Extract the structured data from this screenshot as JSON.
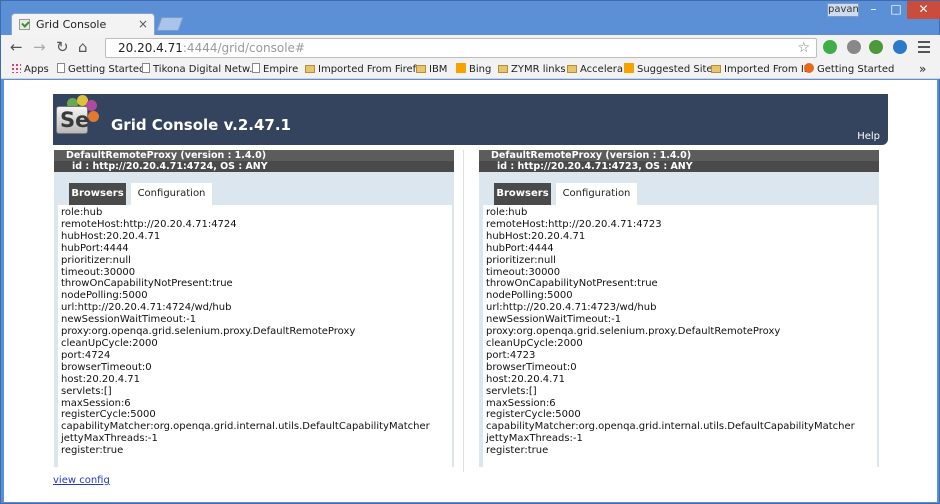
{
  "browser": {
    "tab_title": "Grid Console",
    "tab_close": "×",
    "user": "pavan",
    "min": "–",
    "max": "□",
    "close": "✕",
    "back": "←",
    "forward": "→",
    "reload": "↻",
    "home": "⌂",
    "url_host": "20.20.4.71",
    "url_path": ":4444/grid/console#",
    "star": "☆",
    "more": "»",
    "bookmarks": [
      {
        "label": "Apps",
        "icon": "apps-icon"
      },
      {
        "label": "Getting Started",
        "icon": "page-icon"
      },
      {
        "label": "Tikona Digital Netw...",
        "icon": "page-icon"
      },
      {
        "label": "Empire",
        "icon": "page-icon"
      },
      {
        "label": "Imported From Firef...",
        "icon": "folder-icon"
      },
      {
        "label": "IBM",
        "icon": "folder-icon"
      },
      {
        "label": "Bing",
        "icon": "bing-icon"
      },
      {
        "label": "ZYMR links",
        "icon": "folder-icon"
      },
      {
        "label": "Accelera",
        "icon": "folder-icon"
      },
      {
        "label": "Suggested Sites",
        "icon": "bing-icon"
      },
      {
        "label": "Imported From IE",
        "icon": "folder-icon"
      },
      {
        "label": "Getting Started",
        "icon": "firefox-icon"
      }
    ]
  },
  "page": {
    "logo_text": "Se",
    "title": "Grid Console v.2.47.1",
    "help": "Help",
    "view_config": "view config",
    "proxies": [
      {
        "title": "DefaultRemoteProxy (version : 1.4.0)",
        "id": "id : http://20.20.4.71:4724, OS : ANY",
        "tab_browsers": "Browsers",
        "tab_configuration": "Configuration",
        "config": [
          "role:hub",
          "remoteHost:http://20.20.4.71:4724",
          "hubHost:20.20.4.71",
          "hubPort:4444",
          "prioritizer:null",
          "timeout:30000",
          "throwOnCapabilityNotPresent:true",
          "nodePolling:5000",
          "url:http://20.20.4.71:4724/wd/hub",
          "newSessionWaitTimeout:-1",
          "proxy:org.openqa.grid.selenium.proxy.DefaultRemoteProxy",
          "cleanUpCycle:2000",
          "port:4724",
          "browserTimeout:0",
          "host:20.20.4.71",
          "servlets:[]",
          "maxSession:6",
          "registerCycle:5000",
          "capabilityMatcher:org.openqa.grid.internal.utils.DefaultCapabilityMatcher",
          "jettyMaxThreads:-1",
          "register:true"
        ]
      },
      {
        "title": "DefaultRemoteProxy (version : 1.4.0)",
        "id": "id : http://20.20.4.71:4723, OS : ANY",
        "tab_browsers": "Browsers",
        "tab_configuration": "Configuration",
        "config": [
          "role:hub",
          "remoteHost:http://20.20.4.71:4723",
          "hubHost:20.20.4.71",
          "hubPort:4444",
          "prioritizer:null",
          "timeout:30000",
          "throwOnCapabilityNotPresent:true",
          "nodePolling:5000",
          "url:http://20.20.4.71:4723/wd/hub",
          "newSessionWaitTimeout:-1",
          "proxy:org.openqa.grid.selenium.proxy.DefaultRemoteProxy",
          "cleanUpCycle:2000",
          "port:4723",
          "browserTimeout:0",
          "host:20.20.4.71",
          "servlets:[]",
          "maxSession:6",
          "registerCycle:5000",
          "capabilityMatcher:org.openqa.grid.internal.utils.DefaultCapabilityMatcher",
          "jettyMaxThreads:-1",
          "register:true"
        ]
      }
    ]
  },
  "colors": {
    "frame": "#5b8fd6",
    "header": "#34435e",
    "proxy_title": "#5c5c5c",
    "panel_bg": "#dce6ee",
    "link": "#2536c8"
  }
}
